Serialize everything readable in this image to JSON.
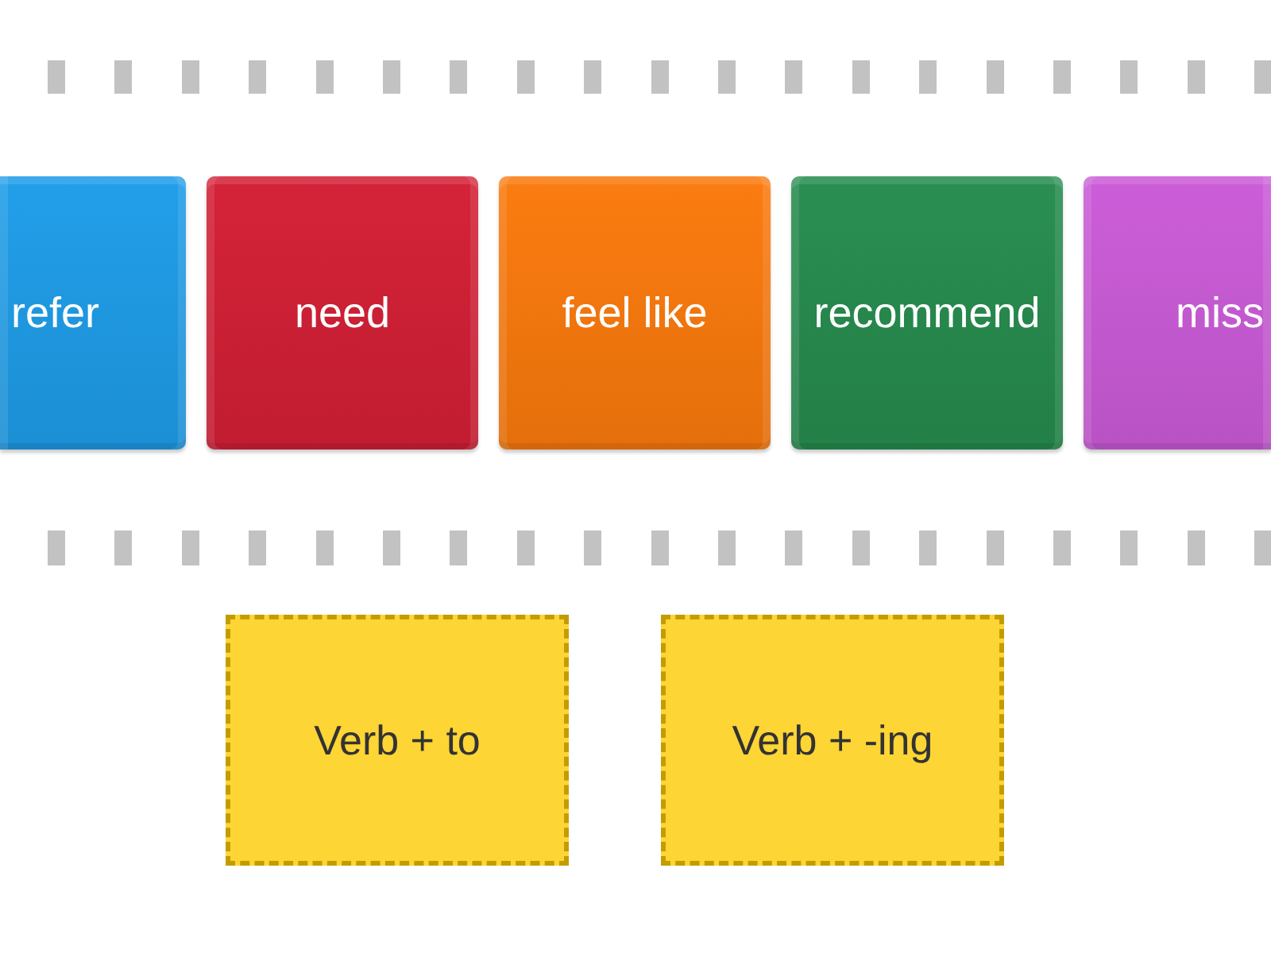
{
  "cards": [
    {
      "label": "refer",
      "color": "#1e9de9",
      "kind": "leftedge"
    },
    {
      "label": "need",
      "color": "#d41f35",
      "kind": "full"
    },
    {
      "label": "feel like",
      "color": "#fb7a0c",
      "kind": "full"
    },
    {
      "label": "recommend",
      "color": "#268c4e",
      "kind": "full"
    },
    {
      "label": "miss",
      "color": "#cb5bd8",
      "kind": "rightedge"
    }
  ],
  "drop_zones": [
    {
      "label": "Verb + to"
    },
    {
      "label": "Verb + -ing"
    }
  ]
}
